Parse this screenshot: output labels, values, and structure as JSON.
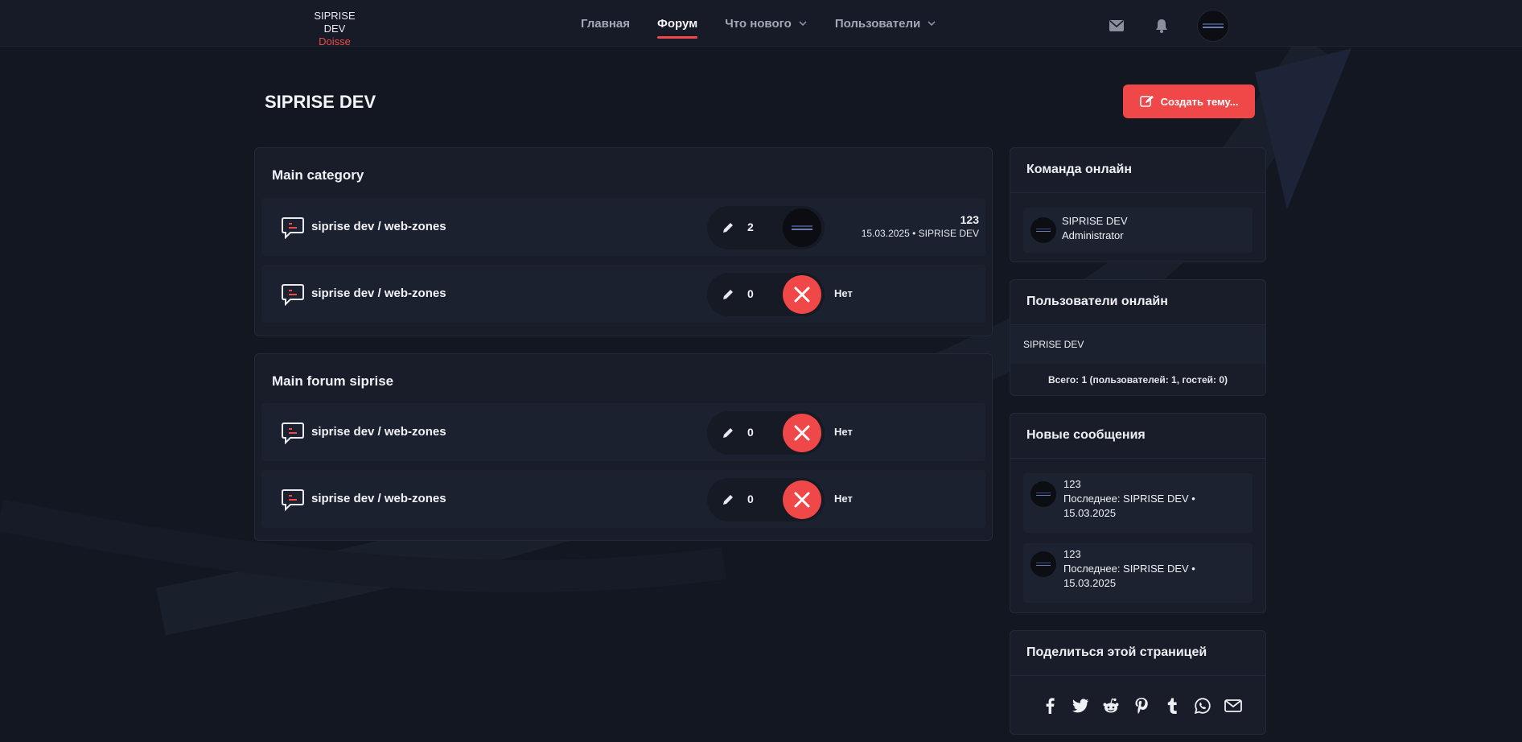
{
  "header": {
    "brand_title": "SIPRISE DEV",
    "brand_sub": "Doisse",
    "nav": [
      {
        "label": "Главная",
        "active": false,
        "dropdown": false
      },
      {
        "label": "Форум",
        "active": true,
        "dropdown": false
      },
      {
        "label": "Что нового",
        "active": false,
        "dropdown": true
      },
      {
        "label": "Пользователи",
        "active": false,
        "dropdown": true
      }
    ],
    "icons": [
      "envelope-icon",
      "bell-icon",
      "user-avatar"
    ]
  },
  "page": {
    "title": "SIPRISE DEV",
    "create_button": "Создать тему..."
  },
  "categories": [
    {
      "title": "Main category",
      "forums": [
        {
          "name": "siprise dev / web-zones",
          "count": "2",
          "last_title": "123",
          "last_meta": "15.03.2025 • SIPRISE DEV",
          "empty": false
        },
        {
          "name": "siprise dev / web-zones",
          "count": "0",
          "none_label": "Нет",
          "empty": true
        }
      ]
    },
    {
      "title": "Main forum siprise",
      "forums": [
        {
          "name": "siprise dev / web-zones",
          "count": "0",
          "none_label": "Нет",
          "empty": true
        },
        {
          "name": "siprise dev / web-zones",
          "count": "0",
          "none_label": "Нет",
          "empty": true
        }
      ]
    }
  ],
  "sidebar": {
    "team": {
      "title": "Команда онлайн",
      "members": [
        {
          "name": "SIPRISE DEV",
          "role": "Administrator"
        }
      ]
    },
    "users": {
      "title": "Пользователи онлайн",
      "list": "SIPRISE DEV",
      "total": "Всего: 1 (пользователей: 1, гостей: 0)"
    },
    "new_posts": {
      "title": "Новые сообщения",
      "items": [
        {
          "title": "123",
          "meta_line1": "Последнее: SIPRISE DEV •",
          "meta_line2": "15.03.2025"
        },
        {
          "title": "123",
          "meta_line1": "Последнее: SIPRISE DEV •",
          "meta_line2": "15.03.2025"
        }
      ]
    },
    "share": {
      "title": "Поделиться этой страницей",
      "icons": [
        "facebook-icon",
        "twitter-icon",
        "reddit-icon",
        "pinterest-icon",
        "tumblr-icon",
        "whatsapp-icon",
        "email-icon"
      ]
    }
  },
  "colors": {
    "accent": "#f04848",
    "background": "#131722",
    "panel": "#181d29",
    "row": "#1c2130"
  }
}
